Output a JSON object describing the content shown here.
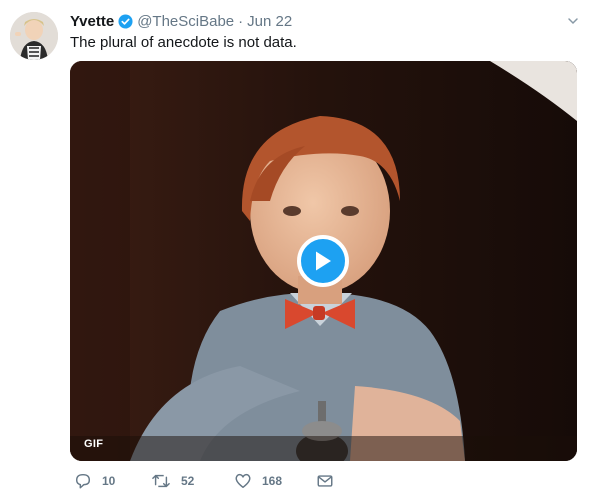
{
  "tweet": {
    "author_name": "Yvette",
    "handle": "@TheSciBabe",
    "separator": "·",
    "date": "Jun 22",
    "text": "The plural of anecdote is not data.",
    "media": {
      "badge": "GIF",
      "play_icon": "play-icon"
    },
    "actions": {
      "reply_count": "10",
      "retweet_count": "52",
      "like_count": "168"
    }
  },
  "colors": {
    "accent": "#1da1f2",
    "muted": "#657786",
    "text": "#14171a"
  }
}
